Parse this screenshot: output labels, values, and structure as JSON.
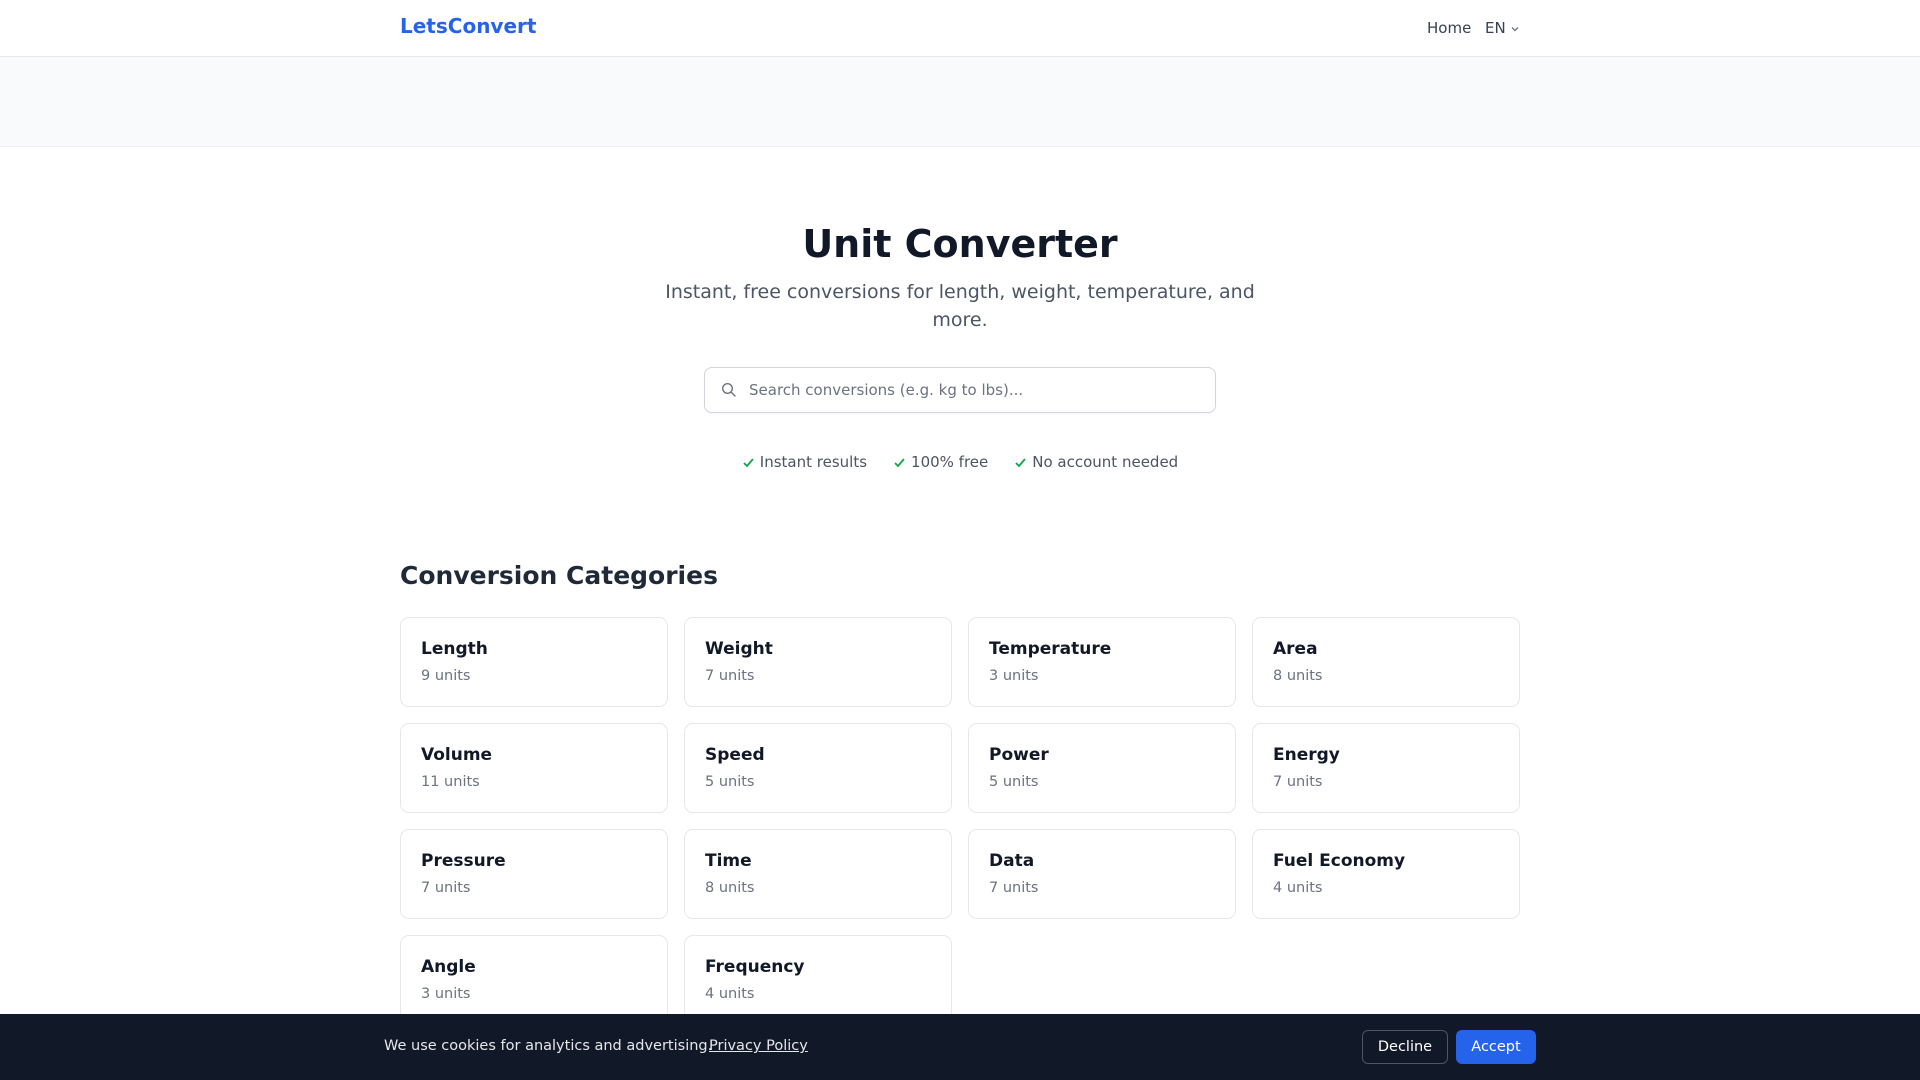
{
  "navbar": {
    "brand": "LetsConvert",
    "home_label": "Home",
    "language": "EN",
    "language_icon": "chevron-down-icon"
  },
  "hero": {
    "title": "Unit Converter",
    "subtitle": "Instant, free conversions for length, weight, temperature, and more."
  },
  "search": {
    "placeholder": "Search conversions (e.g. kg to lbs)...",
    "value": "",
    "icon": "search-icon"
  },
  "features": [
    {
      "label": "Instant results",
      "icon": "check-icon"
    },
    {
      "label": "100% free",
      "icon": "check-icon"
    },
    {
      "label": "No account needed",
      "icon": "check-icon"
    }
  ],
  "categories": {
    "title": "Conversion Categories",
    "items": [
      {
        "name": "Length",
        "units": "9 units"
      },
      {
        "name": "Weight",
        "units": "7 units"
      },
      {
        "name": "Temperature",
        "units": "3 units"
      },
      {
        "name": "Area",
        "units": "8 units"
      },
      {
        "name": "Volume",
        "units": "11 units"
      },
      {
        "name": "Speed",
        "units": "5 units"
      },
      {
        "name": "Power",
        "units": "5 units"
      },
      {
        "name": "Energy",
        "units": "7 units"
      },
      {
        "name": "Pressure",
        "units": "7 units"
      },
      {
        "name": "Time",
        "units": "8 units"
      },
      {
        "name": "Data",
        "units": "7 units"
      },
      {
        "name": "Fuel Economy",
        "units": "4 units"
      },
      {
        "name": "Angle",
        "units": "3 units"
      },
      {
        "name": "Frequency",
        "units": "4 units"
      }
    ]
  },
  "cookie_banner": {
    "text": "We use cookies for analytics and advertising.",
    "privacy_link": "Privacy Policy",
    "decline_label": "Decline",
    "accept_label": "Accept"
  },
  "colors": {
    "brand": "#2563eb",
    "check": "#16a34a",
    "cookie_bg": "#111827"
  }
}
